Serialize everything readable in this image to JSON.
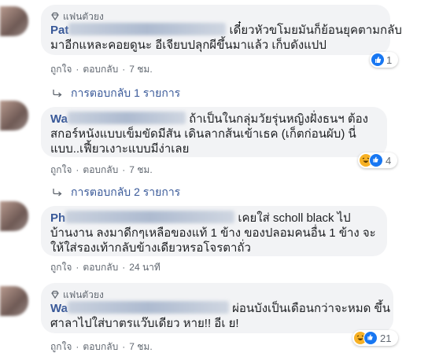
{
  "comments": [
    {
      "badge": "แฟนตัวยง",
      "name": "Pat",
      "lines": [
        "เดี๋ยวหัวขโมยมันก็ย้อนยุคตามกลับ",
        "มาอีกแหละคอยดูนะ อีเจียบปลุกผีขึ้นมาแล้ว เก็บดังแปป"
      ],
      "actions": {
        "like": "ถูกใจ",
        "reply": "ตอบกลับ",
        "time": "7 ชม."
      },
      "reactions": {
        "count": "1",
        "icons": [
          "like-icon"
        ]
      },
      "replies_label": "การตอบกลับ 1 รายการ"
    },
    {
      "badge": "",
      "name": "Wa",
      "lines": [
        "ถ้าเป็นในกลุ่มวัยรุ่นหญิงฝั่งธนฯ ต้อง",
        "สกอร์หนังแบบเข็มขัดมีสัน เดินลากส้นเข้าเธค (เก็ตก่อนผับ) นี่",
        "แบบ..เฟี้ยวเงาะแบบมีง่าเลย"
      ],
      "actions": {
        "like": "ถูกใจ",
        "reply": "ตอบกลับ",
        "time": "7 ชม."
      },
      "reactions": {
        "count": "4",
        "icons": [
          "haha-icon",
          "like-icon"
        ]
      },
      "replies_label": "การตอบกลับ 2 รายการ"
    },
    {
      "badge": "",
      "name": "Ph",
      "lines": [
        "เคยใส่ scholl black ไป",
        "บ้านงาน ลงมาดีกๆเหลือของแท้ 1 ข้าง ของปลอมคนอื่น 1 ข้าง จะ",
        "ให้ใส่รองเท้ากลับข้างเดียวหรอโจรตาถั่ว"
      ],
      "actions": {
        "like": "ถูกใจ",
        "reply": "ตอบกลับ",
        "time": "24 นาที"
      },
      "reactions": null,
      "replies_label": ""
    },
    {
      "badge": "แฟนตัวยง",
      "name": "Wa",
      "lines": [
        "ผ่อนบังเป็นเดือนกว่าจะหมด ขึ้น",
        "ศาลาไปใส่บาตรแว๊บเดียว หาย!! อีเ  ย!"
      ],
      "actions": {
        "like": "ถูกใจ",
        "reply": "ตอบกลับ",
        "time": "7 ชม."
      },
      "reactions": {
        "count": "21",
        "icons": [
          "haha-icon",
          "like-icon"
        ]
      },
      "replies_label": ""
    }
  ],
  "colors": {
    "link": "#385898",
    "bubble": "#f2f3f5",
    "meta": "#606770",
    "text": "#1c1e21",
    "like": "#1877f2",
    "haha": "#f7b125"
  }
}
